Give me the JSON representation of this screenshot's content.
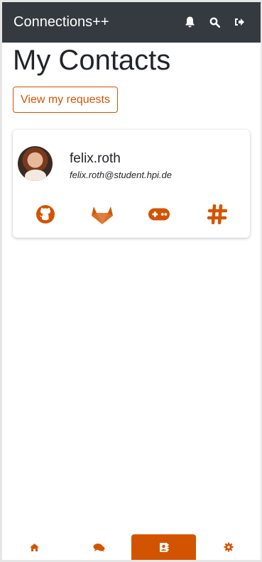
{
  "app": {
    "title": "Connections++"
  },
  "header": {
    "icons": [
      "bell-icon",
      "search-icon",
      "sign-out-icon"
    ]
  },
  "page": {
    "title": "My Contacts"
  },
  "actions": {
    "view_requests_label": "View my requests"
  },
  "contacts": [
    {
      "username": "felix.roth",
      "email": "felix.roth@student.hpi.de",
      "links": [
        "github-icon",
        "gitlab-icon",
        "gamepad-icon",
        "slack-hashtag-icon"
      ]
    }
  ],
  "bottom_nav": {
    "items": [
      "home-icon",
      "chat-icon",
      "contacts-icon",
      "settings-icon"
    ],
    "active": "contacts-icon"
  },
  "colors": {
    "accent": "#d35400",
    "header_bg": "#343a40",
    "text": "#212529"
  }
}
